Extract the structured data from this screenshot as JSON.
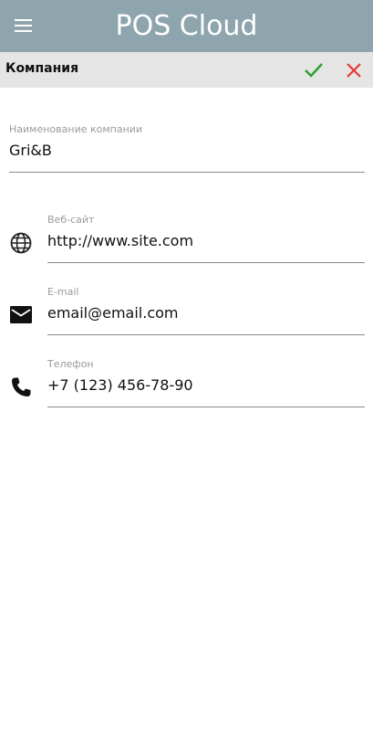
{
  "app": {
    "title": "POS Cloud",
    "menu_icon": "hamburger-menu-icon"
  },
  "header": {
    "section_title": "Компания",
    "confirm_icon": "check-icon",
    "cancel_icon": "close-icon",
    "confirm_color": "#2e9e2e",
    "cancel_color": "#e53935"
  },
  "form": {
    "company": {
      "label": "Наименование компании",
      "value": "Gri&B"
    },
    "website": {
      "label": "Веб-сайт",
      "value": "http://www.site.com",
      "icon": "globe-icon"
    },
    "email": {
      "label": "E-mail",
      "value": "email@email.com",
      "icon": "mail-icon"
    },
    "phone": {
      "label": "Телефон",
      "value": "+7 (123) 456-78-90",
      "icon": "phone-icon"
    }
  },
  "colors": {
    "app_bar": "#8fa5ad",
    "title_bar": "#e5e5e5"
  }
}
